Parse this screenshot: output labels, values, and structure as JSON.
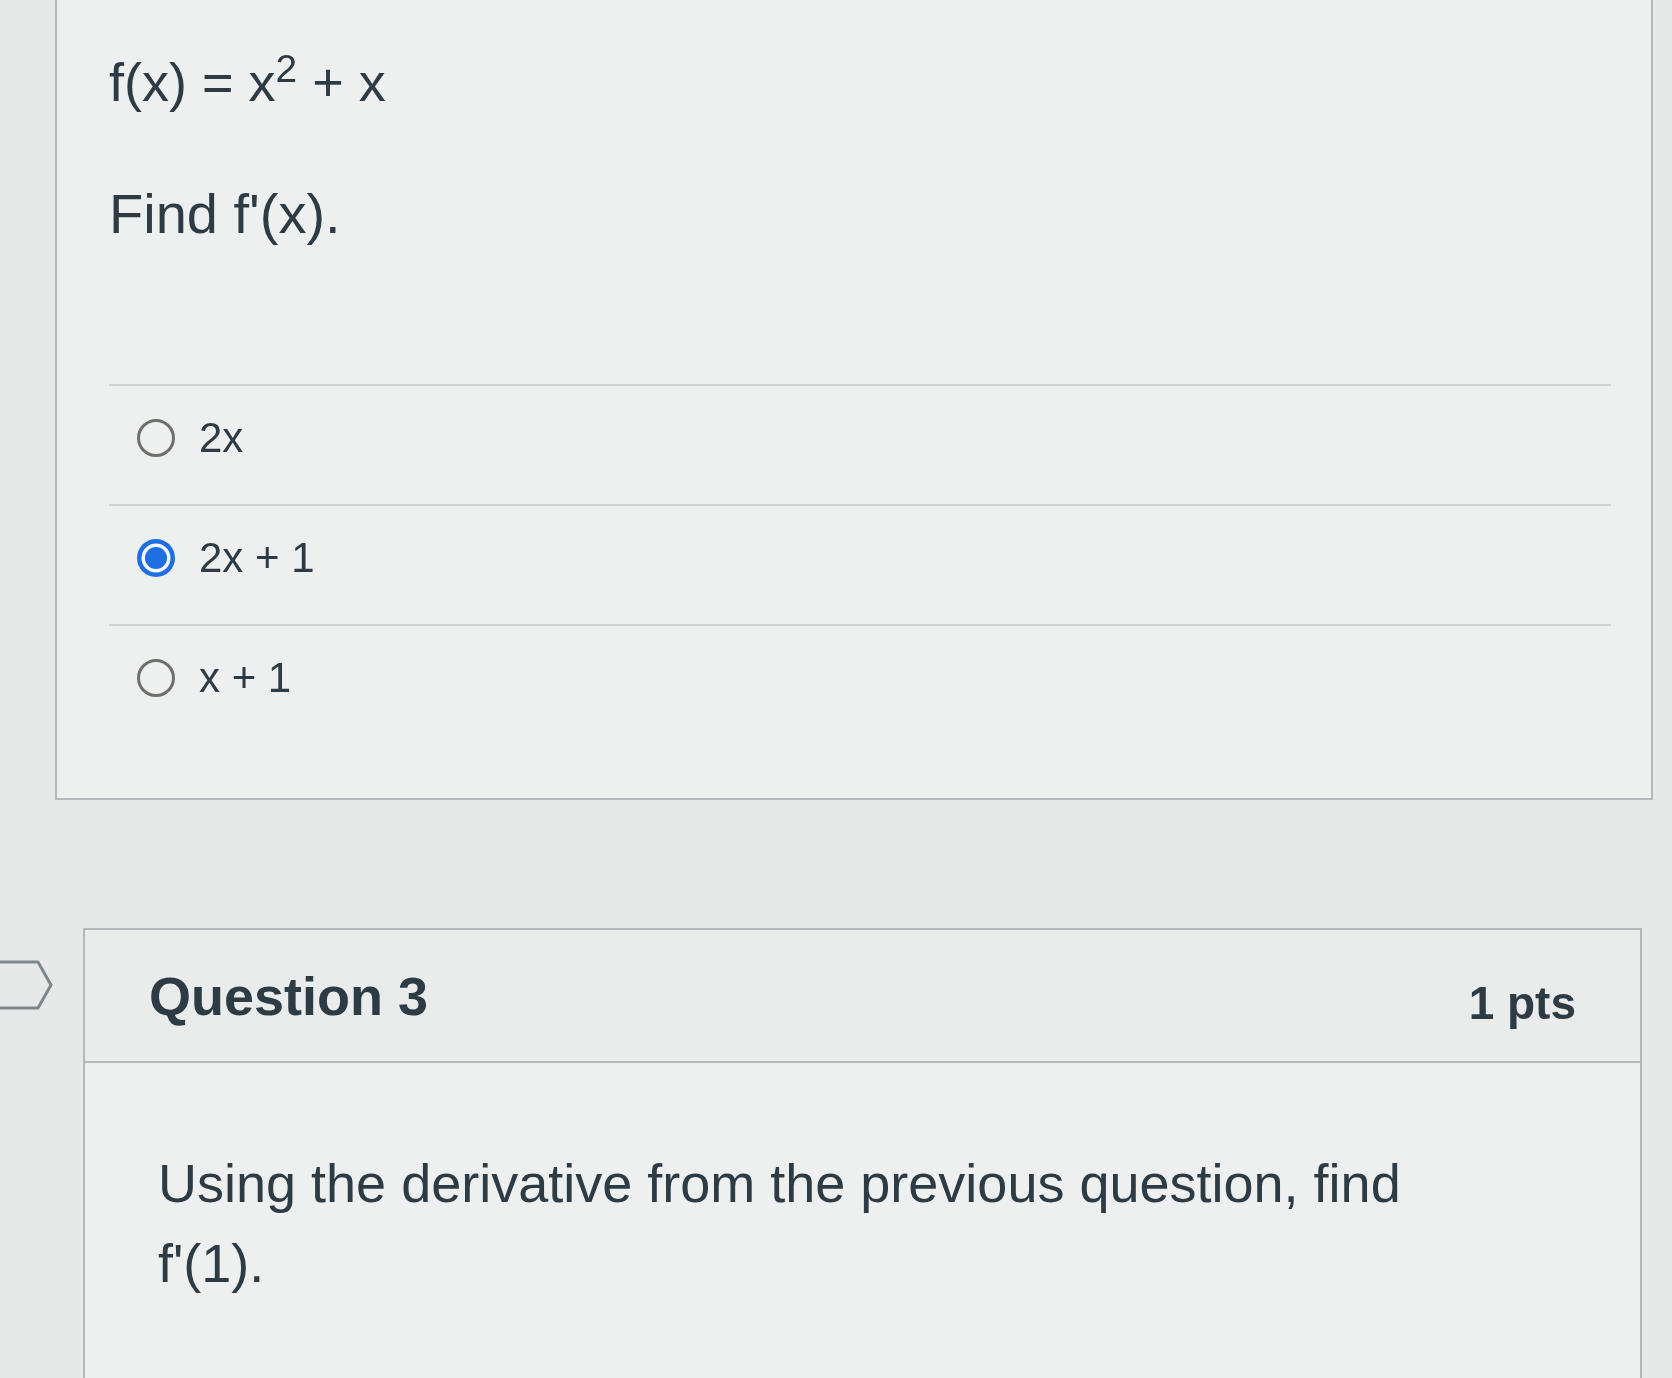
{
  "previous_question": {
    "function": "f(x) = x$^{2}$ + x",
    "prompt": "Find f'(x).",
    "answers": [
      {
        "label": "2x",
        "selected": false
      },
      {
        "label": "2x + 1",
        "selected": true
      },
      {
        "label": "x + 1",
        "selected": false
      }
    ]
  },
  "question": {
    "title": "Question 3",
    "points": "1 pts",
    "flagged": false,
    "text": "Using the derivative from the previous question, find f'(1)."
  }
}
